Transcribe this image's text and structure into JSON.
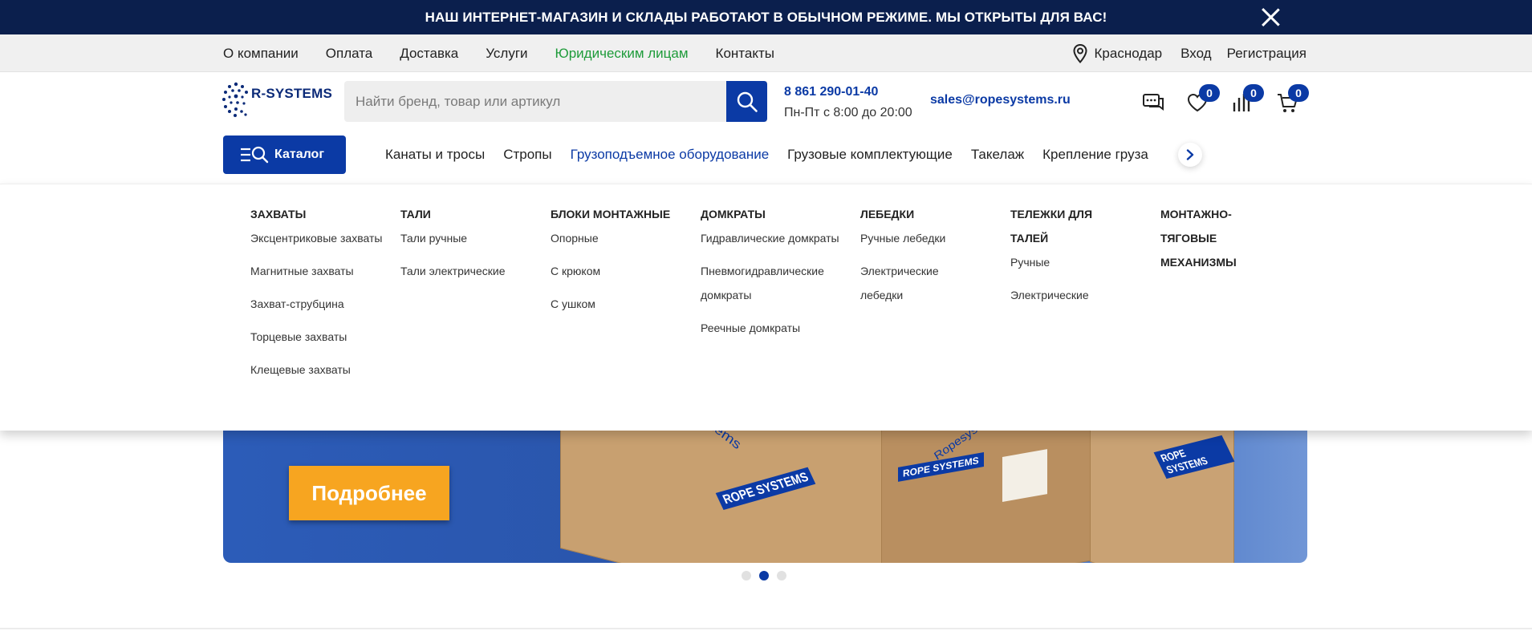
{
  "announcement": {
    "text": "НАШ ИНТЕРНЕТ-МАГАЗИН И СКЛАДЫ РАБОТАЮТ В ОБЫЧНОМ РЕЖИМЕ. МЫ ОТКРЫТЫ ДЛЯ ВАС!"
  },
  "topnav": {
    "items": [
      "О компании",
      "Оплата",
      "Доставка",
      "Услуги",
      "Юридическим лицам",
      "Контакты"
    ],
    "city": "Краснодар",
    "login": "Вход",
    "register": "Регистрация"
  },
  "header": {
    "logo_text": "R-SYSTEMS",
    "search_placeholder": "Найти бренд, товар или артикул",
    "phone": "8 861 290-01-40",
    "hours": "Пн-Пт с 8:00 до 20:00",
    "email": "sales@ropesystems.ru",
    "favorites_count": "0",
    "compare_count": "0",
    "cart_count": "0"
  },
  "catalog": {
    "button_label": "Каталог",
    "categories": [
      "Канаты и тросы",
      "Стропы",
      "Грузоподъемное оборудование",
      "Грузовые комплектующие",
      "Такелаж",
      "Крепление груза"
    ]
  },
  "mega_menu": {
    "columns": [
      {
        "title": "ЗАХВАТЫ",
        "items": [
          "Эксцентриковые захваты",
          "Магнитные захваты",
          "Захват-струбцина",
          "Торцевые захваты",
          "Клещевые захваты"
        ]
      },
      {
        "title": "ТАЛИ",
        "items": [
          "Тали ручные",
          "Тали электрические"
        ]
      },
      {
        "title": "БЛОКИ МОНТАЖНЫЕ",
        "items": [
          "Опорные",
          "С крюком",
          "С ушком"
        ]
      },
      {
        "title": "ДОМКРАТЫ",
        "items": [
          "Гидравлические домкраты",
          "Пневмогидравлические домкраты",
          "Реечные домкраты"
        ]
      },
      {
        "title": "ЛЕБЕДКИ",
        "items": [
          "Ручные лебедки",
          "Электрические лебедки"
        ]
      },
      {
        "title": "ТЕЛЕЖКИ ДЛЯ ТАЛЕЙ",
        "items": [
          "Ручные",
          "Электрические"
        ]
      },
      {
        "title": "МОНТАЖНО-ТЯГОВЫЕ МЕХАНИЗМЫ",
        "items": []
      }
    ]
  },
  "banner": {
    "button_label": "Подробнее",
    "box_text_1": "ROPE SYSTEMS",
    "box_text_2": "ROPE SYSTEMS",
    "box_text_3": "ROPE SYSTEMS",
    "box_print_1": "Ropesystems",
    "box_print_2": "Ropesystems.ru",
    "slides_total": 3,
    "active_slide": 2
  },
  "colors": {
    "brand": "#0b3aa5",
    "announce_bg": "#0b1f4d",
    "accent_green": "#1e9b3a",
    "cta": "#f7a520"
  }
}
